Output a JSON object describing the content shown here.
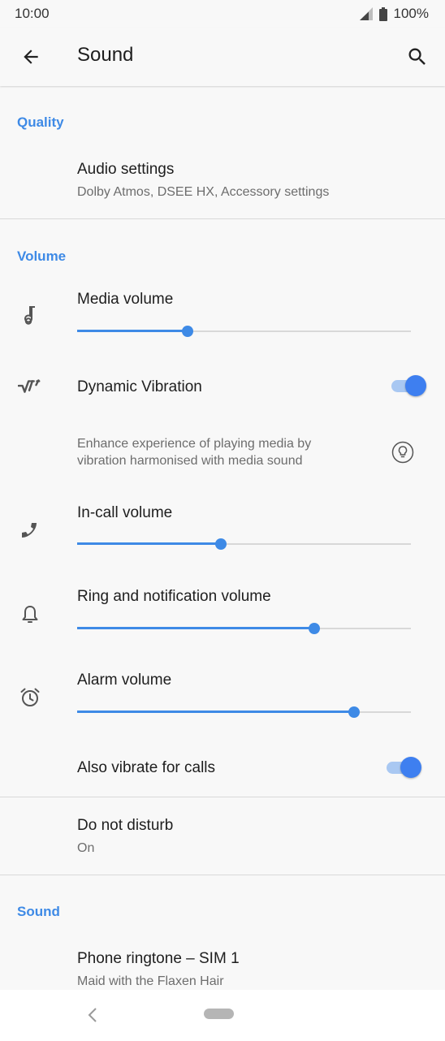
{
  "status": {
    "time": "10:00",
    "battery": "100%"
  },
  "header": {
    "title": "Sound"
  },
  "sections": {
    "quality": "Quality",
    "volume": "Volume",
    "sound": "Sound"
  },
  "audio_settings": {
    "title": "Audio settings",
    "subtitle": "Dolby Atmos, DSEE HX, Accessory settings"
  },
  "media_volume": {
    "title": "Media volume",
    "level": 0.33
  },
  "dynamic_vibration": {
    "title": "Dynamic Vibration",
    "enabled": true,
    "description_line1": "Enhance experience of playing media by",
    "description_line2": "vibration harmonised with media sound"
  },
  "incall_volume": {
    "title": "In-call volume",
    "level": 0.43
  },
  "ring_volume": {
    "title": "Ring and notification volume",
    "level": 0.71
  },
  "alarm_volume": {
    "title": "Alarm volume",
    "level": 0.83
  },
  "vibrate_calls": {
    "title": "Also vibrate for calls",
    "enabled": true
  },
  "dnd": {
    "title": "Do not disturb",
    "subtitle": "On"
  },
  "ringtone": {
    "title": "Phone ringtone – SIM 1",
    "subtitle": "Maid with the Flaxen Hair"
  },
  "colors": {
    "accent": "#3e8ae6",
    "toggle": "#3e7ff0"
  },
  "icons": [
    "signal-icon",
    "battery-icon",
    "back-arrow-icon",
    "search-icon",
    "music-note-icon",
    "vibration-icon",
    "lightbulb-icon",
    "phone-icon",
    "bell-icon",
    "alarm-clock-icon",
    "nav-back-icon"
  ]
}
